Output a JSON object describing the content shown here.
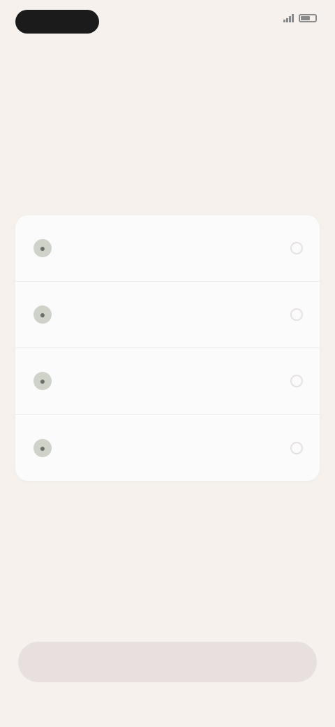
{
  "status_bar": {
    "time": "",
    "right_text": ""
  },
  "header": {
    "eyebrow": "",
    "title": "",
    "subtitle": ""
  },
  "options": [
    {
      "title": "",
      "subtitle": "",
      "icon": "circle-icon"
    },
    {
      "title": "",
      "subtitle": "",
      "icon": "circle-icon"
    },
    {
      "title": "",
      "subtitle": "",
      "icon": "circle-icon"
    },
    {
      "title": "",
      "subtitle": "",
      "icon": "circle-icon"
    }
  ],
  "cta": {
    "label": ""
  },
  "colors": {
    "background": "#f6f1ec",
    "card": "#fcfbfb",
    "accent": "#9bb58c",
    "cta_disabled": "#e7e0df"
  }
}
